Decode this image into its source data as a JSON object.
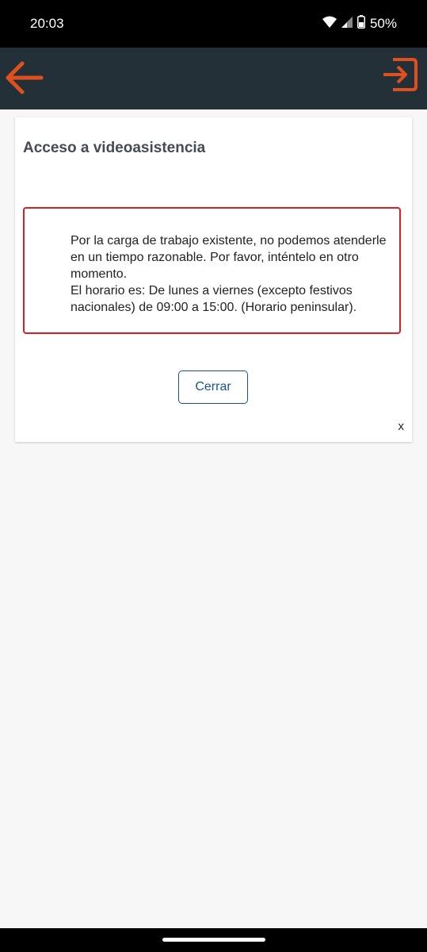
{
  "status_bar": {
    "time": "20:03",
    "battery": "50%",
    "icons": [
      "wifi-icon",
      "signal-icon",
      "battery-icon"
    ]
  },
  "app_bar": {
    "back_icon": "arrow-left-icon",
    "logout_icon": "exit-icon",
    "accent_color": "#e0501e",
    "background_color": "#243038"
  },
  "card": {
    "title": "Acceso a videoasistencia",
    "alert_lines": [
      "Por la carga de trabajo existente, no podemos atenderle en un tiempo razonable. Por favor, inténtelo en otro momento.",
      "El horario es: De lunes a viernes (excepto festivos nacionales) de 09:00 a 15:00. (Horario peninsular)."
    ],
    "close_label": "Cerrar",
    "dismiss_label": "x",
    "alert_border_color": "#d81f26",
    "button_color": "#1b4f94"
  }
}
